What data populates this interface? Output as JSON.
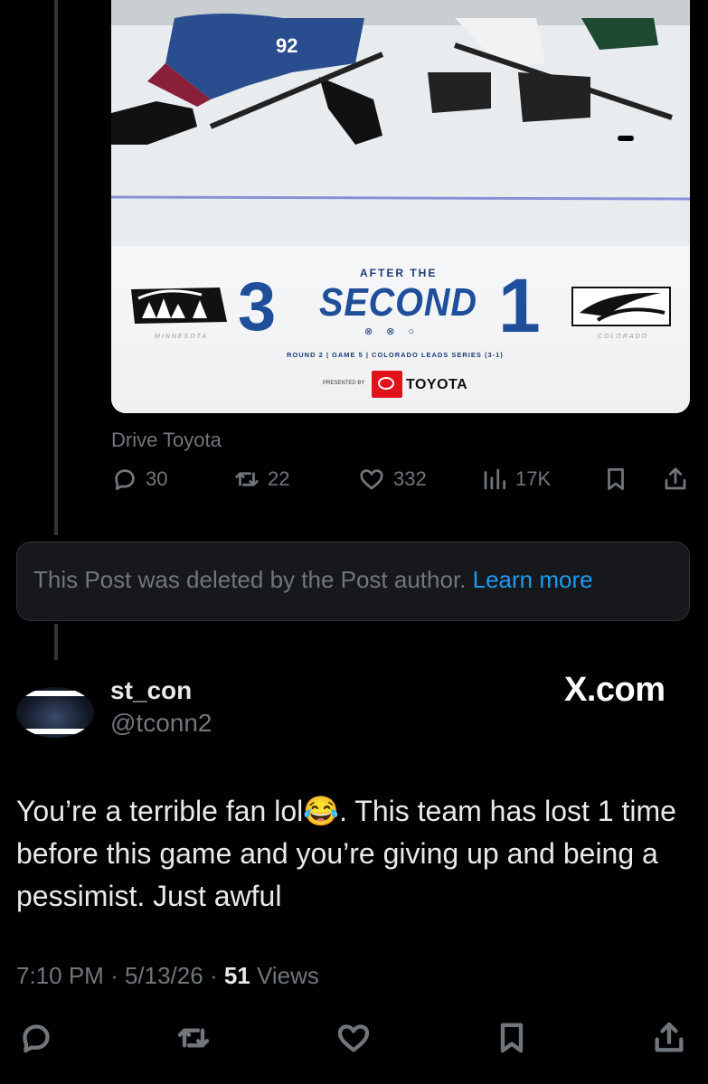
{
  "media": {
    "after_the": "AFTER THE",
    "period": "SECOND",
    "score_home": "3",
    "score_away": "1",
    "team_left": "MINNESOTA",
    "team_right": "COLORADO",
    "dots": "⊗ ⊗ ○",
    "series": "ROUND 2 | GAME 5 | COLORADO LEADS SERIES (3-1)",
    "presented_by": "PRESENTED BY",
    "sponsor": "TOYOTA",
    "jersey_number": "92"
  },
  "source_label": "Drive Toyota",
  "actions": {
    "replies": "30",
    "reposts": "22",
    "likes": "332",
    "views": "17K"
  },
  "deleted": {
    "message": "This Post was deleted by the Post author.",
    "link": "Learn more"
  },
  "reply": {
    "name": "st_con",
    "handle": "@tconn2",
    "watermark": "X.com",
    "text": "You’re a terrible fan lol😂. This team has lost 1 time before this game and you’re giving up and being a pessimist. Just awful",
    "time": "7:10 PM",
    "date": "5/13/26",
    "views_count": "51",
    "views_label": "Views"
  },
  "colors": {
    "background": "#000000",
    "link": "#1d9bf0",
    "muted": "#71767b",
    "text": "#e7e9ea"
  }
}
